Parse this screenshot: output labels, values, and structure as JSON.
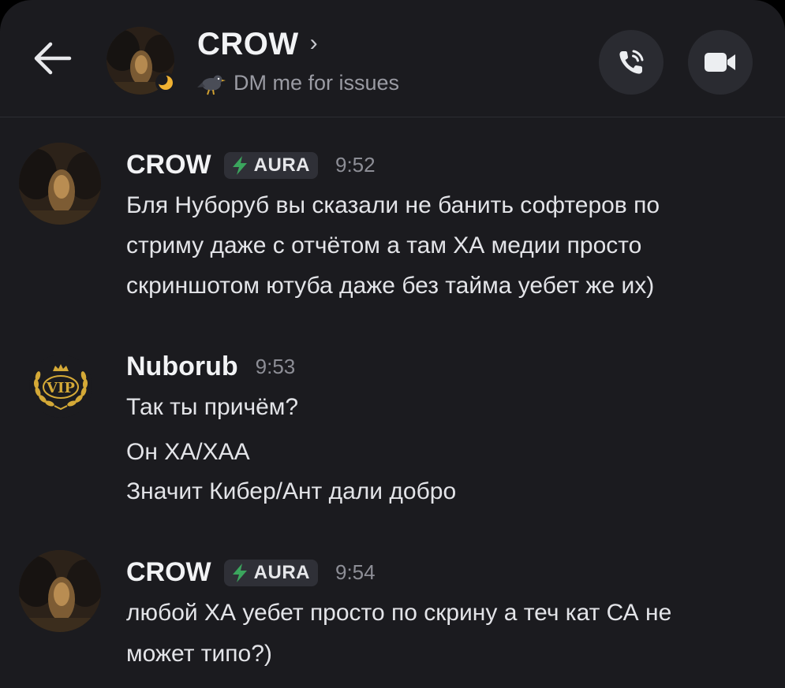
{
  "header": {
    "title": "CROW",
    "chevron": "›",
    "status_text": "DM me for issues",
    "back_icon": "arrow-left-icon",
    "call_icon": "phone-call-icon",
    "video_icon": "video-camera-icon"
  },
  "messages": [
    {
      "author": "CROW",
      "badge": "AURA",
      "time": "9:52",
      "lines": [
        "Бля Нуборуб вы сказали не банить софтеров по",
        "стриму даже с отчётом а там ХА медии просто",
        "скриншотом ютуба даже без тайма уебет же их)"
      ]
    },
    {
      "author": "Nuborub",
      "time": "9:53",
      "avatar_text": "VIP",
      "lines": [
        "Так ты причём?",
        "Он ХА/ХАА",
        "Значит Кибер/Ант дали добро"
      ]
    },
    {
      "author": "CROW",
      "badge": "AURA",
      "time": "9:54",
      "lines": [
        "любой ХА уебет просто по скрину а теч  кат СА не",
        "может типо?)"
      ]
    }
  ],
  "colors": {
    "background": "#1b1b1f",
    "text": "#f2f3f5",
    "muted": "#8d8e96",
    "badge_bg": "#2f3037",
    "lightning": "#3ba55d",
    "vip_gold": "#d4a937"
  }
}
